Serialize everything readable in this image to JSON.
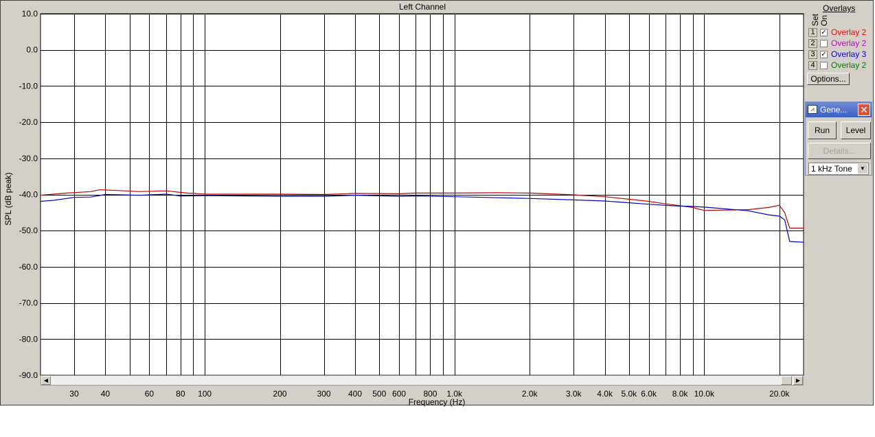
{
  "window": {
    "title": "Left Channel"
  },
  "chart_data": {
    "type": "line",
    "title": "Left Channel",
    "xlabel": "Frequency (Hz)",
    "ylabel": "SPL (dB peak)",
    "xscale": "log",
    "xlim": [
      22,
      25000
    ],
    "ylim": [
      -90,
      10
    ],
    "grid": true,
    "y_ticks": [
      10,
      0,
      -10,
      -20,
      -30,
      -40,
      -50,
      -60,
      -70,
      -80,
      -90
    ],
    "y_tick_labels": [
      "10.0",
      "0.0",
      "-10.0",
      "-20.0",
      "-30.0",
      "-40.0",
      "-50.0",
      "-60.0",
      "-70.0",
      "-80.0",
      "-90.0"
    ],
    "x_gridlines": [
      30,
      40,
      50,
      60,
      70,
      80,
      90,
      100,
      200,
      300,
      400,
      500,
      600,
      700,
      800,
      900,
      1000,
      2000,
      3000,
      4000,
      5000,
      6000,
      7000,
      8000,
      9000,
      10000,
      20000
    ],
    "x_ticks": [
      30,
      40,
      60,
      80,
      100,
      200,
      300,
      400,
      500,
      600,
      800,
      1000,
      2000,
      3000,
      4000,
      5000,
      6000,
      8000,
      10000,
      20000
    ],
    "x_tick_labels": [
      "30",
      "40",
      "60",
      "80",
      "100",
      "200",
      "300",
      "400",
      "500",
      "600",
      "800",
      "1.0k",
      "2.0k",
      "3.0k",
      "4.0k",
      "5.0k",
      "6.0k",
      "8.0k",
      "10.0k",
      "20.0k"
    ],
    "series": [
      {
        "name": "Overlay 2",
        "color": "#c00000",
        "points": [
          [
            22,
            -40.2
          ],
          [
            28,
            -39.6
          ],
          [
            35,
            -39.2
          ],
          [
            38,
            -38.7
          ],
          [
            45,
            -38.9
          ],
          [
            55,
            -39.2
          ],
          [
            70,
            -39.0
          ],
          [
            85,
            -39.6
          ],
          [
            100,
            -39.9
          ],
          [
            200,
            -39.9
          ],
          [
            300,
            -40.0
          ],
          [
            400,
            -39.7
          ],
          [
            600,
            -39.8
          ],
          [
            700,
            -39.6
          ],
          [
            1000,
            -39.6
          ],
          [
            1500,
            -39.5
          ],
          [
            2000,
            -39.6
          ],
          [
            3000,
            -40.1
          ],
          [
            4000,
            -40.6
          ],
          [
            5000,
            -41.3
          ],
          [
            6000,
            -41.9
          ],
          [
            7000,
            -42.6
          ],
          [
            8000,
            -43.1
          ],
          [
            9000,
            -43.6
          ],
          [
            10000,
            -44.4
          ],
          [
            15000,
            -44.2
          ],
          [
            18000,
            -43.6
          ],
          [
            20000,
            -43.0
          ],
          [
            21000,
            -45.0
          ],
          [
            22000,
            -49.3
          ],
          [
            25000,
            -49.3
          ]
        ]
      },
      {
        "name": "Overlay 3",
        "color": "#0000c0",
        "points": [
          [
            22,
            -41.9
          ],
          [
            25,
            -41.6
          ],
          [
            30,
            -40.8
          ],
          [
            35,
            -40.7
          ],
          [
            40,
            -40.0
          ],
          [
            55,
            -40.2
          ],
          [
            70,
            -39.9
          ],
          [
            80,
            -40.4
          ],
          [
            100,
            -40.3
          ],
          [
            200,
            -40.5
          ],
          [
            300,
            -40.5
          ],
          [
            400,
            -40.2
          ],
          [
            600,
            -40.5
          ],
          [
            700,
            -40.4
          ],
          [
            1000,
            -40.6
          ],
          [
            1500,
            -40.9
          ],
          [
            2000,
            -41.1
          ],
          [
            3000,
            -41.5
          ],
          [
            4000,
            -41.8
          ],
          [
            5000,
            -42.3
          ],
          [
            6000,
            -42.7
          ],
          [
            7000,
            -43.0
          ],
          [
            8000,
            -43.2
          ],
          [
            9000,
            -43.3
          ],
          [
            10000,
            -43.5
          ],
          [
            15000,
            -44.5
          ],
          [
            18000,
            -45.6
          ],
          [
            20000,
            -46.0
          ],
          [
            21000,
            -47.0
          ],
          [
            22000,
            -53.0
          ],
          [
            25000,
            -53.2
          ]
        ]
      }
    ]
  },
  "overlays": {
    "title": "Overlays",
    "head_set": "Set",
    "head_on": "On",
    "items": [
      {
        "num": "1",
        "checked": true,
        "mark": "✓",
        "label": "Overlay 2",
        "color": "#ff0000"
      },
      {
        "num": "2",
        "checked": false,
        "mark": "",
        "label": "Overlay 2",
        "color": "#cc00cc"
      },
      {
        "num": "3",
        "checked": true,
        "mark": "✓",
        "label": "Overlay 3",
        "color": "#0000ff"
      },
      {
        "num": "4",
        "checked": false,
        "mark": "",
        "label": "Overlay 2",
        "color": "#008000"
      }
    ],
    "options_label": "Options..."
  },
  "generator": {
    "title": "Gene...",
    "run_label": "Run",
    "level_label": "Level",
    "details_label": "Details...",
    "tone_value": "1 kHz Tone",
    "close_glyph": "✕",
    "icon_glyph": "⩘"
  },
  "scrollbar": {
    "left_arrow": "◀",
    "right_arrow": "▶"
  }
}
